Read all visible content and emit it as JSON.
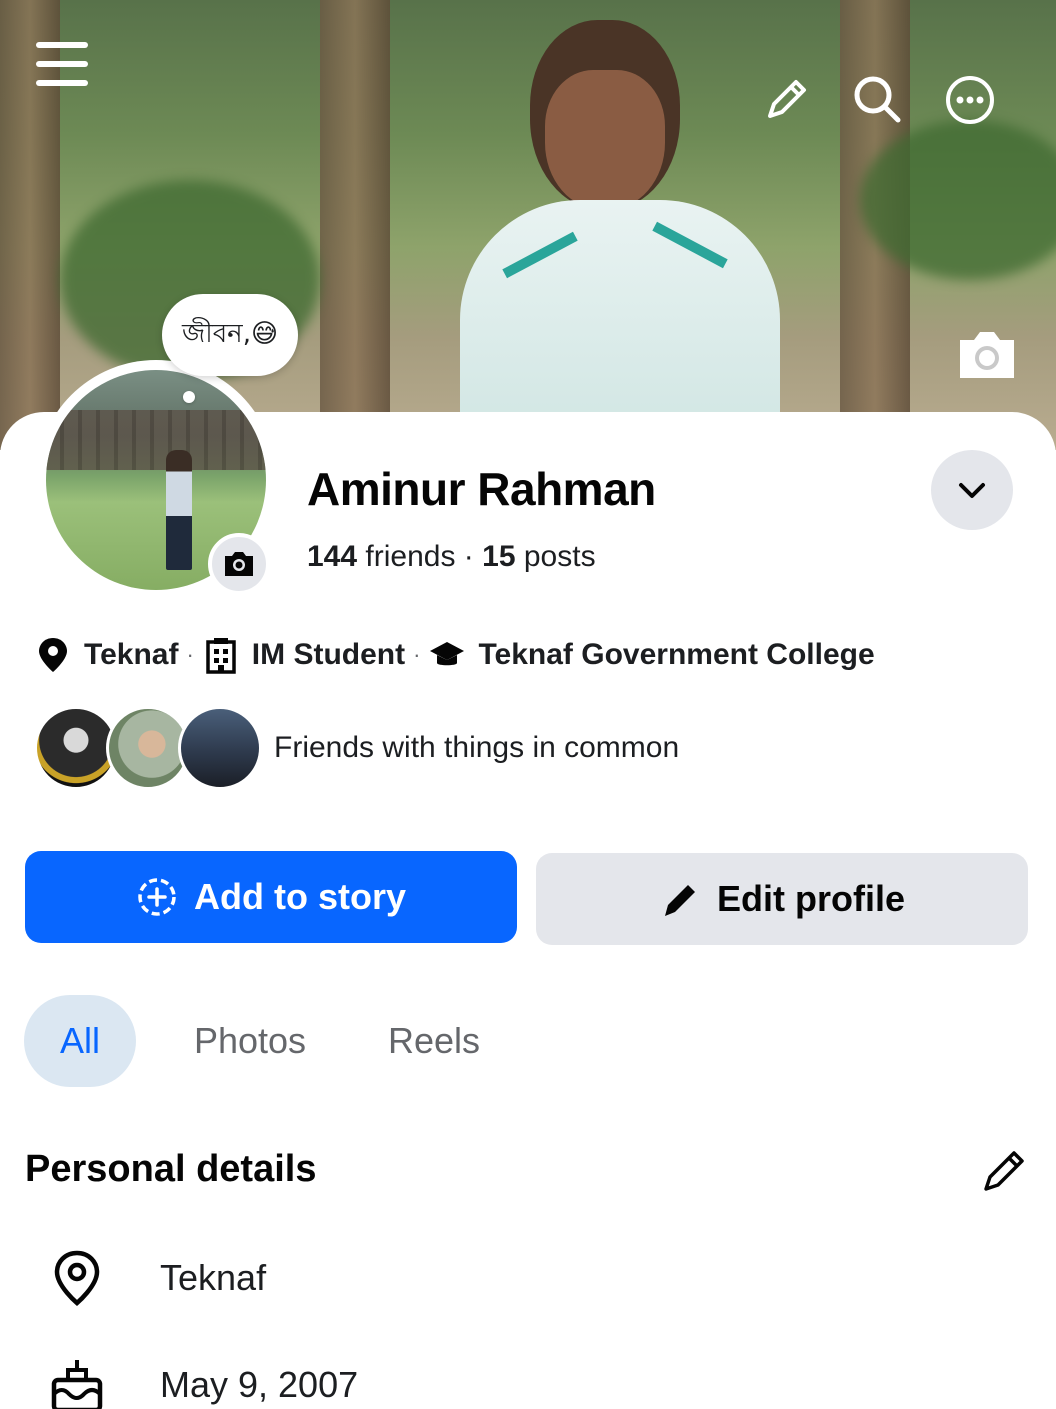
{
  "note": {
    "text": "জীবন,😅"
  },
  "profile": {
    "name": "Aminur Rahman",
    "friends_count": "144",
    "friends_label": "friends",
    "separator": "·",
    "posts_count": "15",
    "posts_label": "posts"
  },
  "info": {
    "location": "Teknaf",
    "work": "IM Student",
    "education": "Teknaf Government College",
    "separator": "·"
  },
  "mutual": {
    "text": "Friends with things in common"
  },
  "actions": {
    "add_story": "Add to story",
    "edit_profile": "Edit profile"
  },
  "tabs": [
    {
      "label": "All",
      "selected": true
    },
    {
      "label": "Photos",
      "selected": false
    },
    {
      "label": "Reels",
      "selected": false
    }
  ],
  "personal_details": {
    "title": "Personal details",
    "items": [
      {
        "icon": "location-pin-icon",
        "text": "Teknaf"
      },
      {
        "icon": "birthday-cake-icon",
        "text": "May 9, 2007"
      }
    ]
  },
  "colors": {
    "accent": "#0866ff",
    "secondary_button": "#e4e6eb",
    "tab_selected_bg": "#dbe7f2"
  }
}
